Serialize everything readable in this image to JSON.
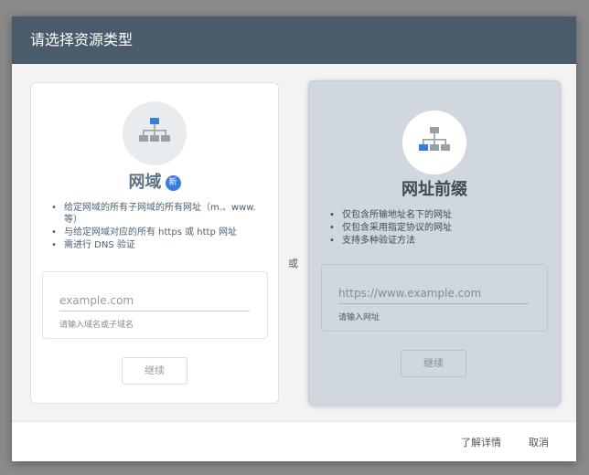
{
  "dialog": {
    "title": "请选择资源类型",
    "separator": "或",
    "learn_more": "了解详情",
    "cancel": "取消"
  },
  "domain_card": {
    "title": "网域",
    "badge": "新",
    "bullets": [
      "给定网域的所有子网域的所有网址（m.、www. 等）",
      "与给定网域对应的所有 https 或 http 网址",
      "需进行 DNS 验证"
    ],
    "placeholder": "example.com",
    "helper": "请输入域名或子域名",
    "continue": "继续"
  },
  "prefix_card": {
    "title": "网址前缀",
    "bullets": [
      "仅包含所输地址名下的网址",
      "仅包含采用指定协议的网址",
      "支持多种验证方法"
    ],
    "placeholder": "https://www.example.com",
    "helper": "请输入网址",
    "continue": "继续"
  },
  "colors": {
    "header": "#4a5c69",
    "badge": "#3a7dd8",
    "selected_card": "#d1d7de",
    "icon_gray": "#9aa0a6",
    "icon_blue": "#3a7dd8"
  }
}
